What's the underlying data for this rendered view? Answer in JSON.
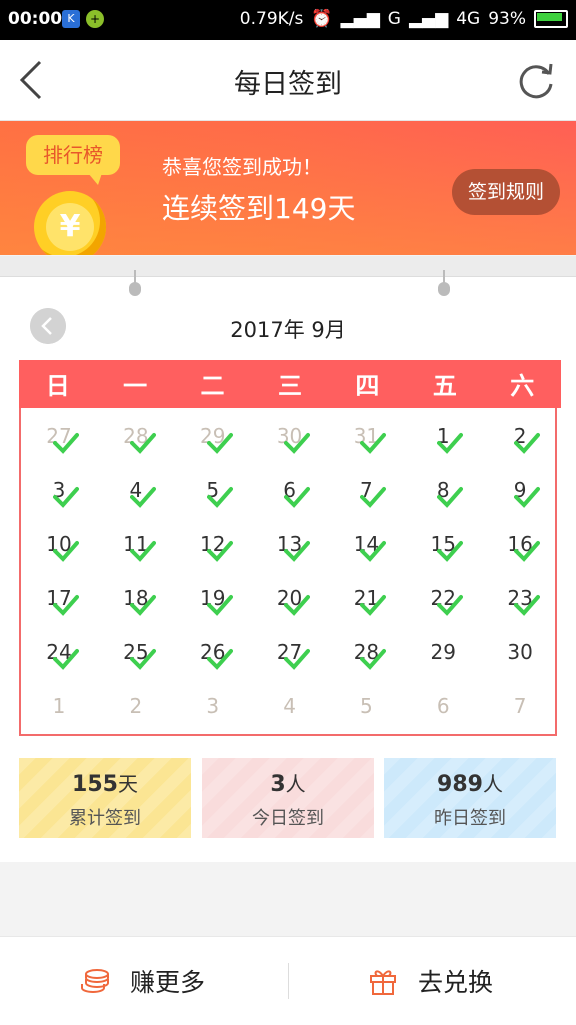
{
  "status": {
    "time": "00:00",
    "speed": "0.79K/s",
    "network1": "G",
    "network2": "4G",
    "battery": "93%"
  },
  "header": {
    "title": "每日签到"
  },
  "banner": {
    "rank_label": "排行榜",
    "coin_symbol": "¥",
    "message": "恭喜您签到成功！",
    "streak": "连续签到149天",
    "rules_button": "签到规则"
  },
  "calendar": {
    "month_label": "2017年 9月",
    "weekdays": [
      "日",
      "一",
      "二",
      "三",
      "四",
      "五",
      "六"
    ],
    "days": [
      {
        "d": "27",
        "other": true,
        "checked": true
      },
      {
        "d": "28",
        "other": true,
        "checked": true
      },
      {
        "d": "29",
        "other": true,
        "checked": true
      },
      {
        "d": "30",
        "other": true,
        "checked": true
      },
      {
        "d": "31",
        "other": true,
        "checked": true
      },
      {
        "d": "1",
        "other": false,
        "checked": true
      },
      {
        "d": "2",
        "other": false,
        "checked": true
      },
      {
        "d": "3",
        "other": false,
        "checked": true
      },
      {
        "d": "4",
        "other": false,
        "checked": true
      },
      {
        "d": "5",
        "other": false,
        "checked": true
      },
      {
        "d": "6",
        "other": false,
        "checked": true
      },
      {
        "d": "7",
        "other": false,
        "checked": true
      },
      {
        "d": "8",
        "other": false,
        "checked": true
      },
      {
        "d": "9",
        "other": false,
        "checked": true
      },
      {
        "d": "10",
        "other": false,
        "checked": true
      },
      {
        "d": "11",
        "other": false,
        "checked": true
      },
      {
        "d": "12",
        "other": false,
        "checked": true
      },
      {
        "d": "13",
        "other": false,
        "checked": true
      },
      {
        "d": "14",
        "other": false,
        "checked": true
      },
      {
        "d": "15",
        "other": false,
        "checked": true
      },
      {
        "d": "16",
        "other": false,
        "checked": true
      },
      {
        "d": "17",
        "other": false,
        "checked": true
      },
      {
        "d": "18",
        "other": false,
        "checked": true
      },
      {
        "d": "19",
        "other": false,
        "checked": true
      },
      {
        "d": "20",
        "other": false,
        "checked": true
      },
      {
        "d": "21",
        "other": false,
        "checked": true
      },
      {
        "d": "22",
        "other": false,
        "checked": true
      },
      {
        "d": "23",
        "other": false,
        "checked": true
      },
      {
        "d": "24",
        "other": false,
        "checked": true
      },
      {
        "d": "25",
        "other": false,
        "checked": true
      },
      {
        "d": "26",
        "other": false,
        "checked": true
      },
      {
        "d": "27",
        "other": false,
        "checked": true
      },
      {
        "d": "28",
        "other": false,
        "checked": true
      },
      {
        "d": "29",
        "other": false,
        "checked": false
      },
      {
        "d": "30",
        "other": false,
        "checked": false
      },
      {
        "d": "1",
        "other": true,
        "checked": false
      },
      {
        "d": "2",
        "other": true,
        "checked": false
      },
      {
        "d": "3",
        "other": true,
        "checked": false
      },
      {
        "d": "4",
        "other": true,
        "checked": false
      },
      {
        "d": "5",
        "other": true,
        "checked": false
      },
      {
        "d": "6",
        "other": true,
        "checked": false
      },
      {
        "d": "7",
        "other": true,
        "checked": false
      }
    ]
  },
  "stats": [
    {
      "value": "155",
      "unit": "天",
      "label": "累计签到",
      "color": "#fbe593"
    },
    {
      "value": "3",
      "unit": "人",
      "label": "今日签到",
      "color": "#f9dcdc"
    },
    {
      "value": "989",
      "unit": "人",
      "label": "昨日签到",
      "color": "#cde9fb"
    }
  ],
  "bottom": {
    "earn_label": "赚更多",
    "exchange_label": "去兑换"
  },
  "colors": {
    "accent": "#ff5f5f",
    "check": "#3ecf4f",
    "icon_orange": "#f0683c"
  }
}
